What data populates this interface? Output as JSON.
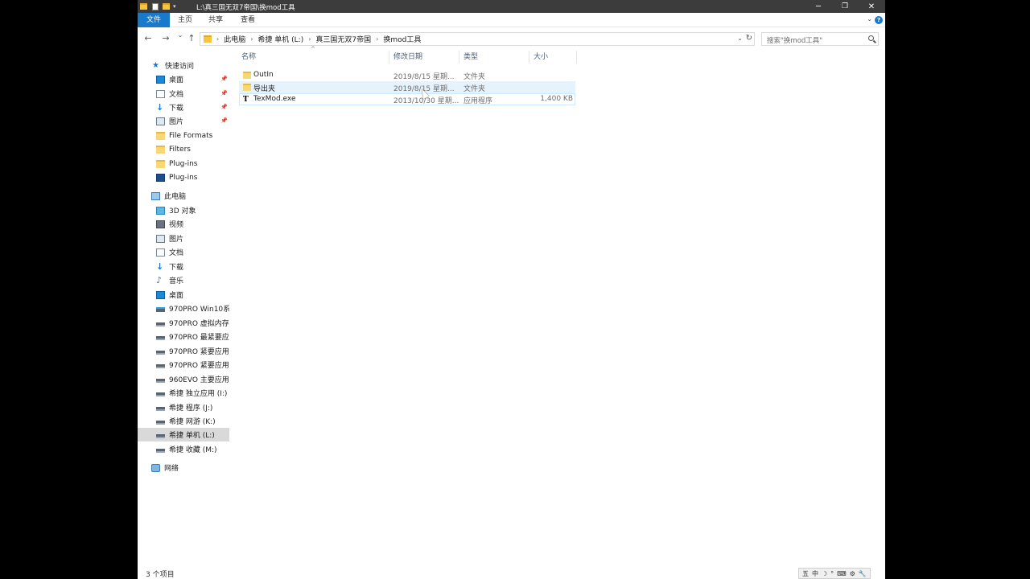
{
  "window": {
    "title": "L:\\真三国无双7帝国\\换mod工具",
    "controls": {
      "minimize": "─",
      "restore": "❐",
      "close": "✕"
    }
  },
  "ribbon": {
    "tabs": [
      {
        "label": "文件",
        "active": true
      },
      {
        "label": "主页"
      },
      {
        "label": "共享"
      },
      {
        "label": "查看"
      }
    ],
    "help_label": "?"
  },
  "nav": {
    "back": "←",
    "forward": "→",
    "recent": "⌄",
    "up": "↑",
    "breadcrumb": [
      "此电脑",
      "希捷 单机 (L:)",
      "真三国无双7帝国",
      "换mod工具"
    ],
    "search_placeholder": "搜索\"换mod工具\""
  },
  "sidebar": {
    "quick_access": "快速访问",
    "quick_items": [
      {
        "label": "桌面",
        "icon": "desktop-icon",
        "pinned": true
      },
      {
        "label": "文档",
        "icon": "document-icon",
        "pinned": true
      },
      {
        "label": "下载",
        "icon": "download-icon",
        "pinned": true
      },
      {
        "label": "图片",
        "icon": "picture-icon",
        "pinned": true
      },
      {
        "label": "File Formats",
        "icon": "folder-icon"
      },
      {
        "label": "Filters",
        "icon": "folder-icon"
      },
      {
        "label": "Plug-ins",
        "icon": "folder-icon"
      },
      {
        "label": "Plug-ins",
        "icon": "plugin-folder-icon"
      }
    ],
    "this_pc": "此电脑",
    "pc_items": [
      {
        "label": "3D 对象",
        "icon": "3d-objects-icon"
      },
      {
        "label": "视频",
        "icon": "video-icon"
      },
      {
        "label": "图片",
        "icon": "picture-icon"
      },
      {
        "label": "文档",
        "icon": "document-icon"
      },
      {
        "label": "下载",
        "icon": "download-icon"
      },
      {
        "label": "音乐",
        "icon": "music-icon"
      },
      {
        "label": "桌面",
        "icon": "desktop-icon"
      },
      {
        "label": "970PRO Win10系统",
        "icon": "system-drive-icon"
      },
      {
        "label": "970PRO 虚拟内存",
        "icon": "drive-icon"
      },
      {
        "label": "970PRO 最紧要应用",
        "icon": "drive-icon"
      },
      {
        "label": "970PRO 紧要应用",
        "icon": "drive-icon"
      },
      {
        "label": "970PRO 紧要应用",
        "icon": "drive-icon"
      },
      {
        "label": "960EVO 主要应用",
        "icon": "drive-icon"
      },
      {
        "label": "希捷 独立应用 (I:)",
        "icon": "drive-icon"
      },
      {
        "label": "希捷 程序 (J:)",
        "icon": "drive-icon"
      },
      {
        "label": "希捷 网游 (K:)",
        "icon": "drive-icon"
      },
      {
        "label": "希捷 单机 (L:)",
        "icon": "drive-icon",
        "selected": true
      },
      {
        "label": "希捷 收藏 (M:)",
        "icon": "drive-icon"
      }
    ],
    "network": "网络"
  },
  "columns": {
    "name": "名称",
    "date": "修改日期",
    "type": "类型",
    "size": "大小"
  },
  "files": [
    {
      "name": "OutIn",
      "date": "2019/8/15 星期...",
      "type": "文件夹",
      "size": "",
      "icon": "folder-icon"
    },
    {
      "name": "导出夹",
      "date": "2019/8/15 星期...",
      "type": "文件夹",
      "size": "",
      "icon": "folder-icon"
    },
    {
      "name": "TexMod.exe",
      "date": "2013/10/30 星期...",
      "type": "应用程序",
      "size": "1,400 KB",
      "icon": "texmod-app-icon"
    }
  ],
  "status": {
    "item_count": "3 个项目"
  },
  "tray": {
    "ime": [
      "五",
      "中",
      "☽",
      "°",
      "⌨",
      "⚙",
      "🔧"
    ]
  },
  "colors": {
    "accent": "#1979ca",
    "titlebar": "#3c3c3c",
    "hover": "#e5f3ff",
    "selected": "#d9d9d9"
  }
}
